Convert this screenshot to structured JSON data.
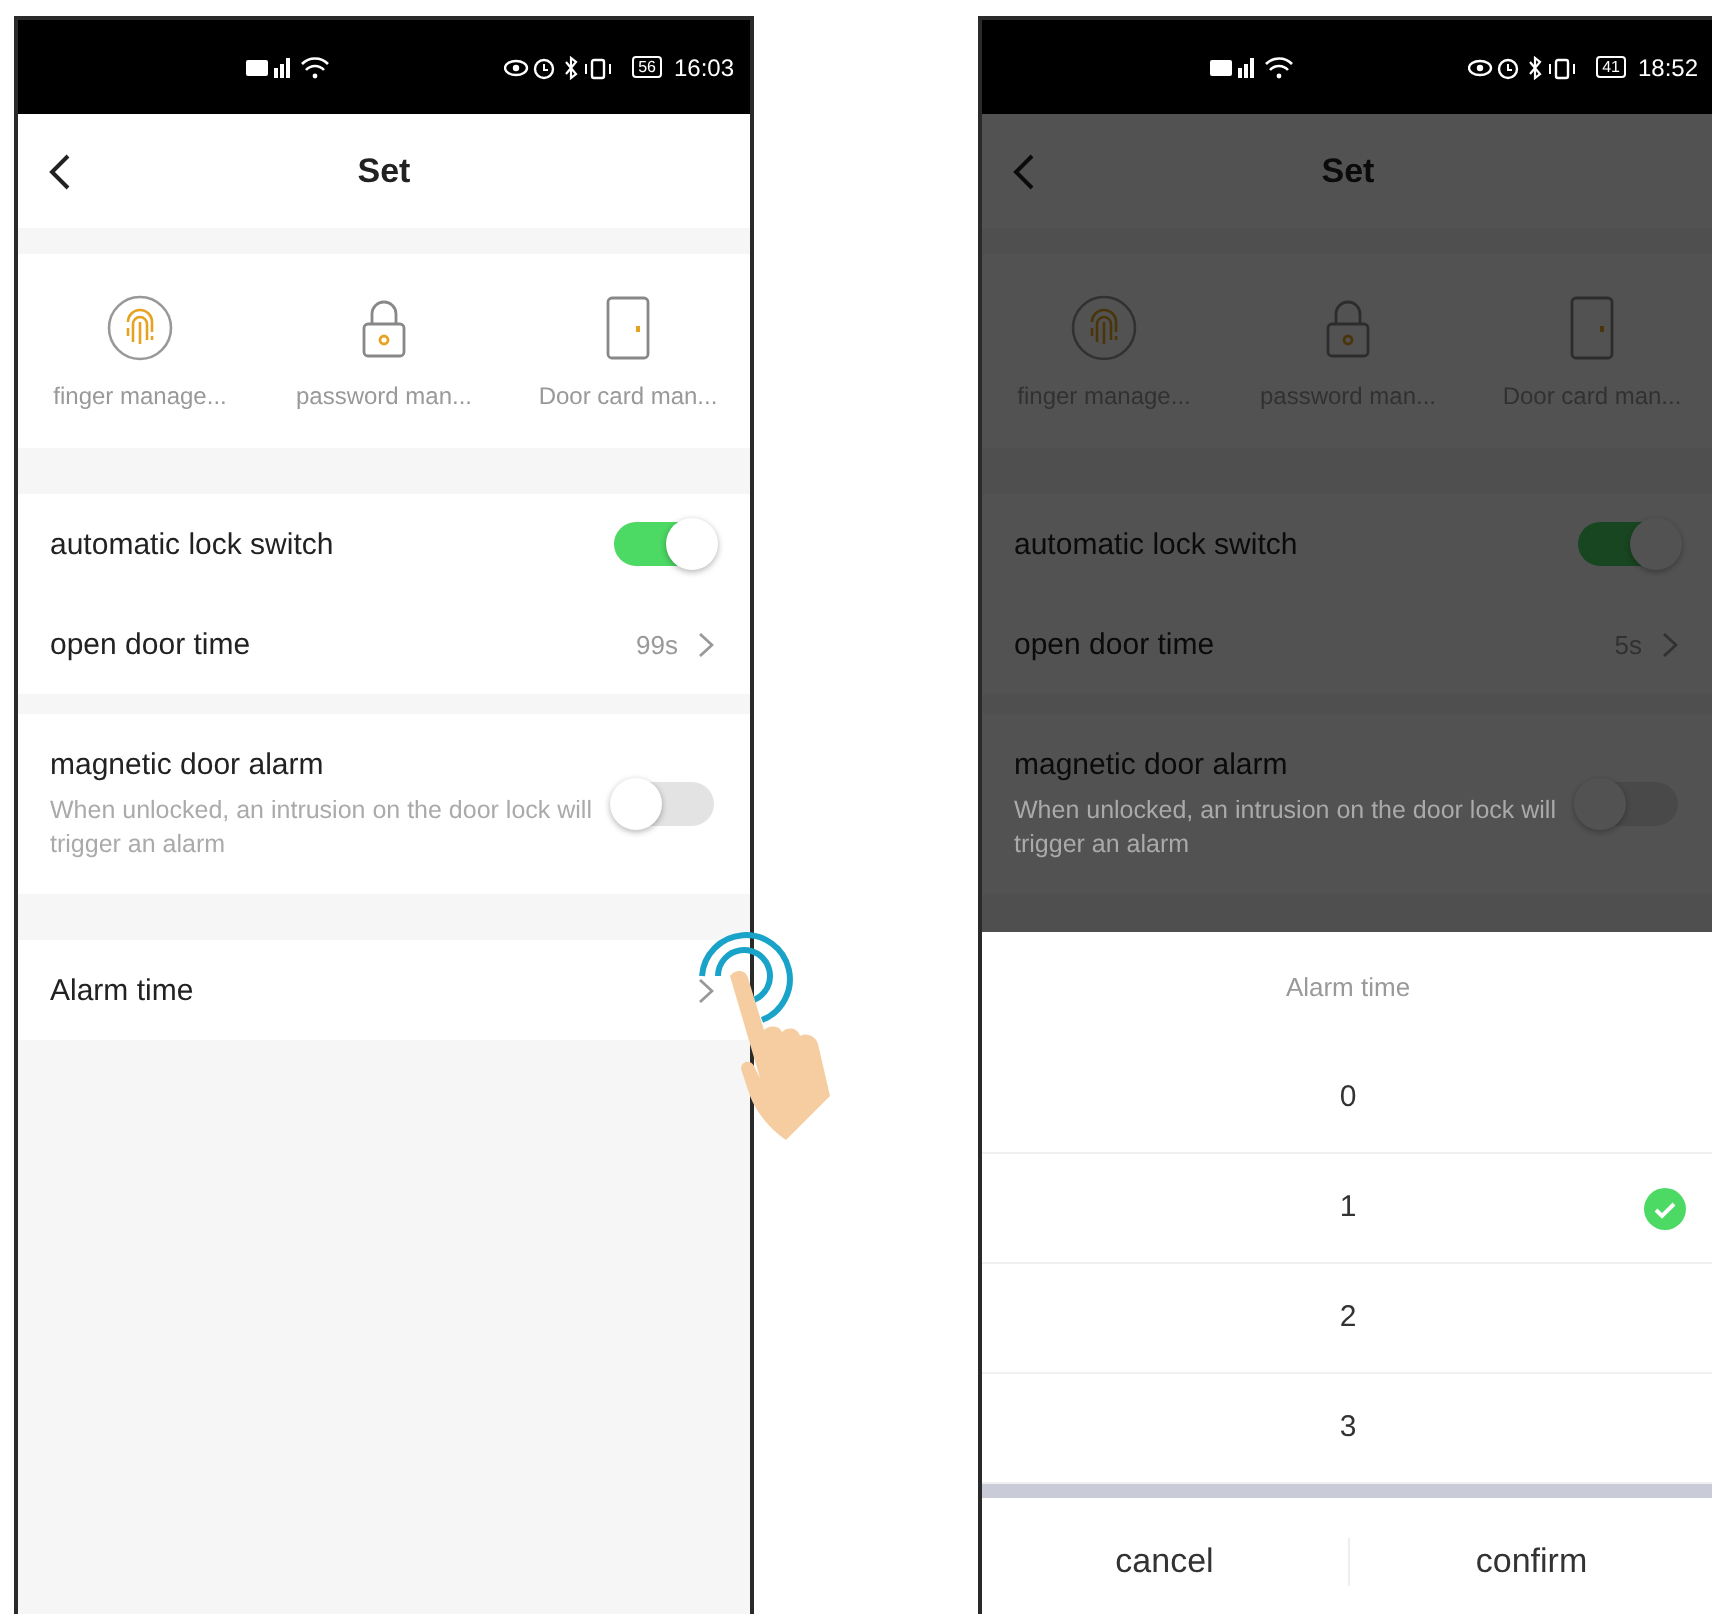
{
  "screens": [
    {
      "status_bar": {
        "battery": "56",
        "time": "16:03"
      },
      "title": "Set",
      "dimmed": false,
      "shortcuts": [
        {
          "kind": "fingerprint",
          "label": "finger manage..."
        },
        {
          "kind": "password",
          "label": "password man..."
        },
        {
          "kind": "card",
          "label": "Door card man..."
        }
      ],
      "groups": [
        {
          "items": [
            {
              "kind": "toggle",
              "label": "automatic lock switch",
              "on": true
            },
            {
              "kind": "value",
              "label": "open door time",
              "value": "99s"
            }
          ]
        },
        {
          "items": [
            {
              "kind": "toggle",
              "label": "magnetic door alarm",
              "description": "When unlocked, an intrusion on the door lock will trigger an alarm",
              "on": false
            }
          ]
        },
        {
          "items": [
            {
              "kind": "nav",
              "label": "Alarm time",
              "tapped": true
            }
          ]
        }
      ]
    },
    {
      "status_bar": {
        "battery": "41",
        "time": "18:52"
      },
      "title": "Set",
      "dimmed": true,
      "shortcuts": [
        {
          "kind": "fingerprint",
          "label": "finger manage..."
        },
        {
          "kind": "password",
          "label": "password man..."
        },
        {
          "kind": "card",
          "label": "Door card man..."
        }
      ],
      "groups": [
        {
          "items": [
            {
              "kind": "toggle",
              "label": "automatic lock switch",
              "on": true
            },
            {
              "kind": "value",
              "label": "open door time",
              "value": "5s"
            }
          ]
        },
        {
          "items": [
            {
              "kind": "toggle",
              "label": "magnetic door alarm",
              "description": "When unlocked, an intrusion on the door lock will trigger an alarm",
              "on": false
            }
          ]
        }
      ],
      "picker": {
        "title": "Alarm time",
        "options": [
          {
            "label": "0",
            "selected": false
          },
          {
            "label": "1",
            "selected": true
          },
          {
            "label": "2",
            "selected": false
          },
          {
            "label": "3",
            "selected": false
          }
        ],
        "buttons": [
          "cancel",
          "confirm"
        ]
      }
    }
  ]
}
